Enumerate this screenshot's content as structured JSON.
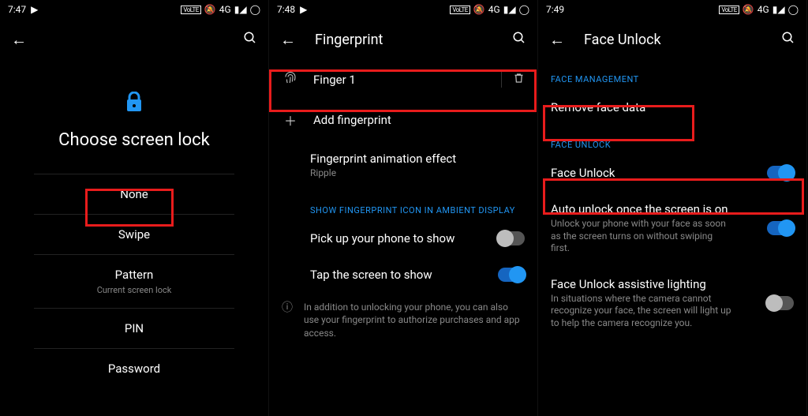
{
  "screen1": {
    "time": "7:47",
    "volte": "VoLTE",
    "signal_text": "4G",
    "title_page": "Choose screen lock",
    "options": {
      "none": "None",
      "swipe": "Swipe",
      "pattern": "Pattern",
      "pattern_sub": "Current screen lock",
      "pin": "PIN",
      "password": "Password"
    }
  },
  "screen2": {
    "time": "7:48",
    "volte": "VoLTE",
    "signal_text": "4G",
    "header": "Fingerprint",
    "finger1": "Finger 1",
    "add": "Add fingerprint",
    "anim_title": "Fingerprint animation effect",
    "anim_sub": "Ripple",
    "section_ambient": "SHOW FINGERPRINT ICON IN AMBIENT DISPLAY",
    "pickup": "Pick up your phone to show",
    "tap": "Tap the screen to show",
    "info": "In addition to unlocking your phone, you can also use your fingerprint to authorize purchases and app access."
  },
  "screen3": {
    "time": "7:49",
    "volte": "VoLTE",
    "signal_text": "4G",
    "header": "Face Unlock",
    "section_management": "FACE MANAGEMENT",
    "remove": "Remove face data",
    "section_unlock": "FACE UNLOCK",
    "face_unlock": "Face Unlock",
    "auto_title": "Auto unlock once the screen is on",
    "auto_sub": "Unlock your phone with your face as soon as the screen turns on without swiping first.",
    "assist_title": "Face Unlock assistive lighting",
    "assist_sub": "In situations where the camera cannot recognize your face, the screen will light up to help the camera recognize you."
  }
}
